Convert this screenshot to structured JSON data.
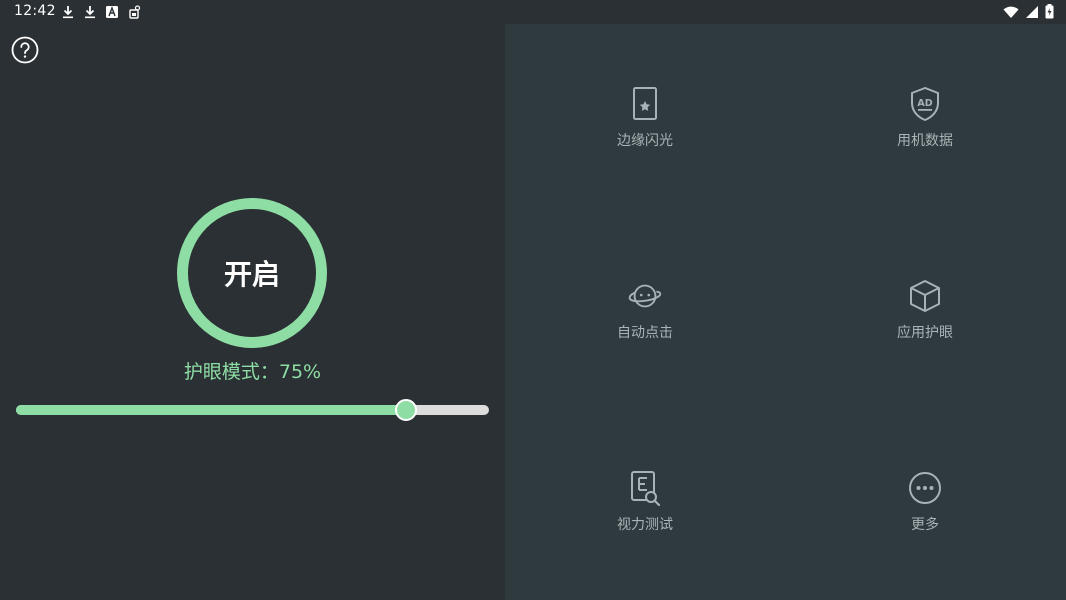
{
  "status_bar": {
    "time": "12:42",
    "left_icons": [
      "download-icon",
      "download-icon",
      "app-store-icon",
      "cleaner-icon"
    ],
    "right_icons": [
      "wifi-icon",
      "cellular-signal-icon",
      "battery-icon"
    ]
  },
  "left_panel": {
    "help_icon": "help-icon",
    "power_button_label": "开启",
    "mode_text": "护眼模式：75%",
    "slider_value_percent": 75,
    "accent_color": "#8edda4"
  },
  "features": [
    {
      "label": "边缘闪光",
      "icon": "edge-flash-icon"
    },
    {
      "label": "用机数据",
      "icon": "ad-shield-icon"
    },
    {
      "label": "自动点击",
      "icon": "planet-face-icon"
    },
    {
      "label": "应用护眼",
      "icon": "cube-icon"
    },
    {
      "label": "视力测试",
      "icon": "vision-test-icon"
    },
    {
      "label": "更多",
      "icon": "more-icon"
    }
  ]
}
